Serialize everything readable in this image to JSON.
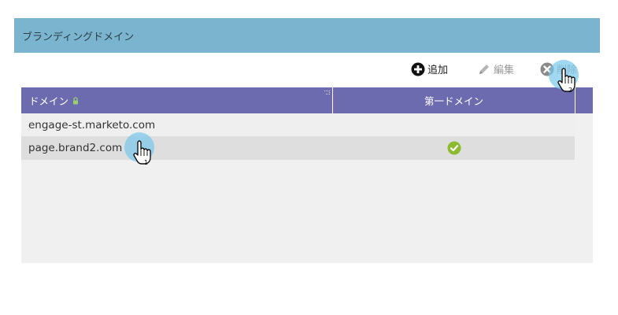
{
  "panel": {
    "title": "ブランディングドメイン"
  },
  "toolbar": {
    "add_label": "追加",
    "edit_label": "編集",
    "delete_label": "削除"
  },
  "grid": {
    "columns": [
      "ドメイン",
      "第一ドメイン"
    ],
    "rows": [
      {
        "domain": "engage-st.marketo.com",
        "primary": false
      },
      {
        "domain": "page.brand2.com",
        "primary": true
      }
    ]
  },
  "cursors": [
    {
      "step": "1"
    },
    {
      "step": "2"
    }
  ],
  "colors": {
    "header": "#7ab4ce",
    "grid_header": "#6d6bb0",
    "check": "#8dbb2f"
  }
}
